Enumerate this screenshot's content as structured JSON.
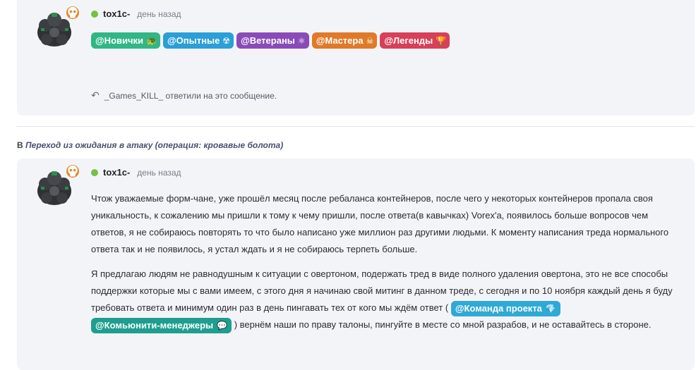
{
  "post1": {
    "author": "tox1c-",
    "time": "день назад",
    "tags": [
      {
        "label": "@Новички",
        "icon": "turtle-icon",
        "glyph": "🐢",
        "color": "#2fb784"
      },
      {
        "label": "@Опытные",
        "icon": "radiation-icon",
        "glyph": "☢",
        "color": "#2a9fd8"
      },
      {
        "label": "@Ветераны",
        "icon": "atom-icon",
        "glyph": "⚛",
        "color": "#8a4bb8"
      },
      {
        "label": "@Мастера",
        "icon": "skull-icon",
        "glyph": "☠",
        "color": "#e07a28"
      },
      {
        "label": "@Легенды",
        "icon": "trophy-icon",
        "glyph": "🏆",
        "color": "#d83f58"
      }
    ],
    "reply_user": "_Games_KILL_",
    "reply_text": "ответили на это сообщение."
  },
  "thread": {
    "prefix": "В",
    "title": "Переход из ожидания в атаку (операция: кровавые болота)"
  },
  "post2": {
    "author": "tox1c-",
    "time": "день назад",
    "paragraph1": "Чтож уважаемые форм-чане, уже прошёл месяц после ребаланса контейнеров, после чего у некоторых контейнеров пропала своя уникальность, к сожалению мы пришли к тому к чему пришли, после ответа(в кавычках) Vorex'а, появилось больше вопросов чем ответов, я не собираюсь повторять то что было написано уже миллион раз другими людьми. К моменту написания треда нормального ответа так и не появилось, я устал ждать и я не собираюсь терпеть больше.",
    "paragraph2_start": "Я предлагаю людям не равнодушным к ситуации с овертоном, подержать тред в виде полного удаления овертона, это не все способы поддержки которые мы с вами имеем, с этого дня я начинаю свой митинг в данном треде, с сегодня и по 10 ноября каждый день я буду требовать ответа и минимум один раз в день пингавать тех от кого мы ждём ответ (",
    "tag_team": "@Команда проекта",
    "tag_team_color": "#2fa9d6",
    "tag_cm": "@Комьюнити-менеджеры",
    "tag_cm_color": "#1e9e8e",
    "paragraph2_end": ") вернём наши по праву талоны, пингуйте в месте со мной разрабов, и не оставайтесь в стороне."
  },
  "colors": {
    "online": "#74c045",
    "badge": "#e2892a",
    "card_bg": "#f3f4f8"
  }
}
